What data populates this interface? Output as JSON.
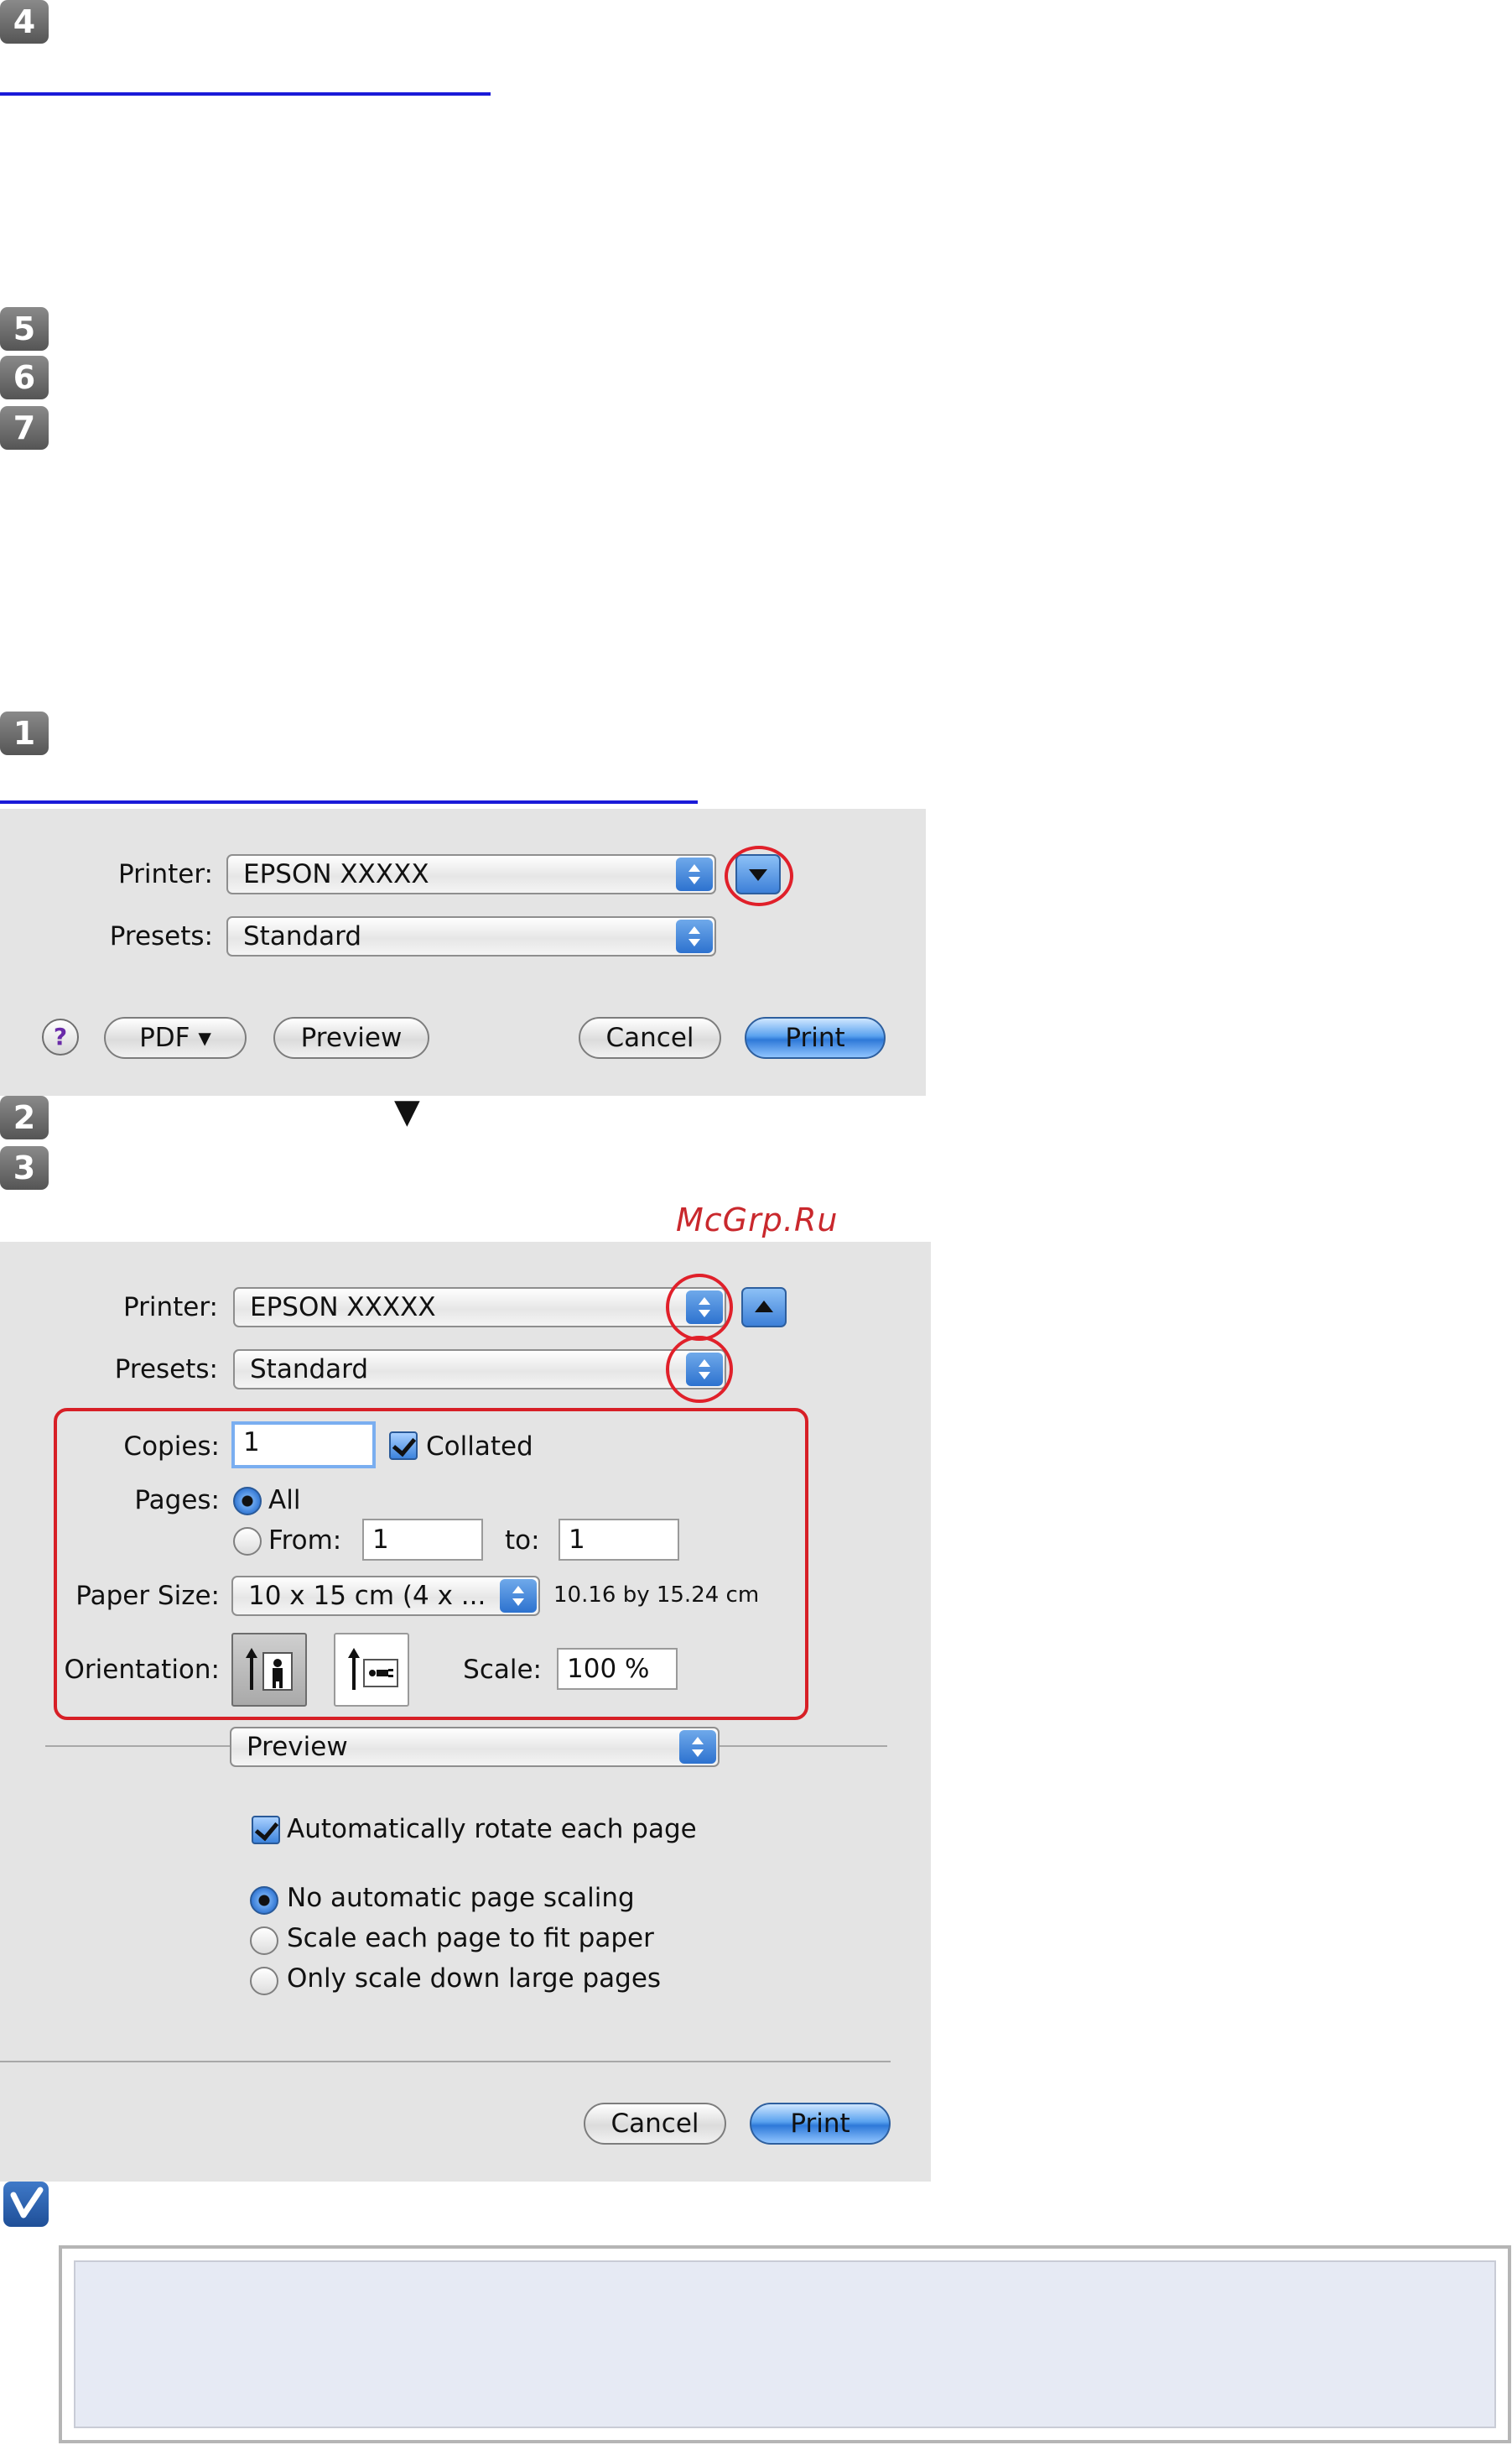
{
  "steps": {
    "s4": "4",
    "s5": "5",
    "s6": "6",
    "s7": "7",
    "s1": "1",
    "s2": "2",
    "s3": "3"
  },
  "step2_arrow": "▼",
  "watermark": "McGrp.Ru",
  "dialog1": {
    "printer_label": "Printer:",
    "printer_value": "EPSON XXXXX",
    "presets_label": "Presets:",
    "presets_value": "Standard",
    "help": "?",
    "pdf_button": "PDF ▾",
    "preview_button": "Preview",
    "cancel_button": "Cancel",
    "print_button": "Print"
  },
  "dialog2": {
    "printer_label": "Printer:",
    "printer_value": "EPSON XXXXX",
    "presets_label": "Presets:",
    "presets_value": "Standard",
    "copies_label": "Copies:",
    "copies_value": "1",
    "collated_label": "Collated",
    "pages_label": "Pages:",
    "pages_all": "All",
    "pages_from": "From:",
    "from_value": "1",
    "to_label": "to:",
    "to_value": "1",
    "paper_size_label": "Paper Size:",
    "paper_size_value": "10 x 15 cm (4 x ...",
    "paper_size_dims": "10.16 by 15.24 cm",
    "orientation_label": "Orientation:",
    "scale_label": "Scale:",
    "scale_value": "100 %",
    "section_popup": "Preview",
    "auto_rotate": "Automatically rotate each page",
    "scaling_options": [
      "No automatic page scaling",
      "Scale each page to fit paper",
      "Only scale down large pages"
    ],
    "cancel_button": "Cancel",
    "print_button": "Print"
  }
}
